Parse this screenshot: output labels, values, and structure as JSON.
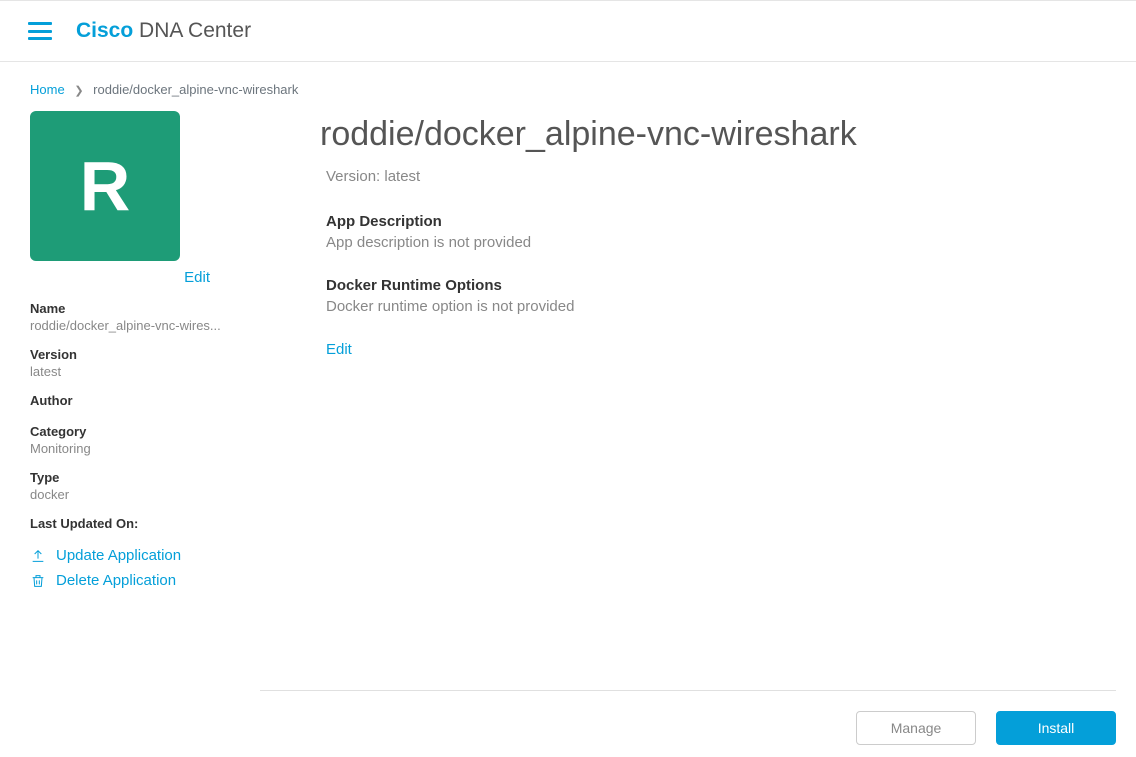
{
  "header": {
    "brand_bold": "Cisco",
    "brand_rest": " DNA Center"
  },
  "breadcrumb": {
    "home": "Home",
    "current": "roddie/docker_alpine-vnc-wireshark"
  },
  "sidebar": {
    "icon_letter": "R",
    "edit_label": "Edit",
    "meta": {
      "name_label": "Name",
      "name_value": "roddie/docker_alpine-vnc-wires...",
      "version_label": "Version",
      "version_value": "latest",
      "author_label": "Author",
      "author_value": "",
      "category_label": "Category",
      "category_value": "Monitoring",
      "type_label": "Type",
      "type_value": "docker",
      "updated_label": "Last Updated On:",
      "updated_value": ""
    },
    "actions": {
      "update": "Update Application",
      "delete": "Delete Application"
    }
  },
  "main": {
    "title": "roddie/docker_alpine-vnc-wireshark",
    "version_prefix": "Version: ",
    "version_value": "latest",
    "desc_heading": "App Description",
    "desc_body": "App description is not provided",
    "runtime_heading": "Docker Runtime Options",
    "runtime_body": "Docker runtime option is not provided",
    "edit_label": "Edit"
  },
  "footer": {
    "manage": "Manage",
    "install": "Install"
  }
}
